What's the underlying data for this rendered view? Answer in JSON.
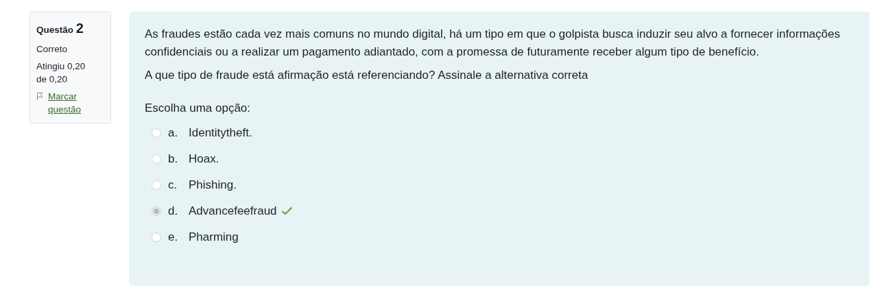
{
  "info": {
    "label": "Questão",
    "number": "2",
    "state": "Correto",
    "grade": "Atingiu 0,20 de 0,20",
    "flag_link": "Marcar questão"
  },
  "question": {
    "paragraphs": [
      "As fraudes estão cada vez mais comuns no mundo digital, há um tipo em que o golpista busca induzir seu alvo a fornecer informações confidenciais ou a realizar um pagamento adiantado, com a promessa de futuramente receber algum tipo de benefício.",
      "A que tipo de fraude está afirmação está referenciando? Assinale a alternativa correta"
    ],
    "prompt": "Escolha uma opção:",
    "options": [
      {
        "letter": "a.",
        "text": "Identitytheft.",
        "selected": false,
        "correct": false
      },
      {
        "letter": "b.",
        "text": "Hoax.",
        "selected": false,
        "correct": false
      },
      {
        "letter": "c.",
        "text": "Phishing.",
        "selected": false,
        "correct": false
      },
      {
        "letter": "d.",
        "text": "Advancefeefraud",
        "selected": true,
        "correct": true
      },
      {
        "letter": "e.",
        "text": "Pharming",
        "selected": false,
        "correct": false
      }
    ]
  }
}
